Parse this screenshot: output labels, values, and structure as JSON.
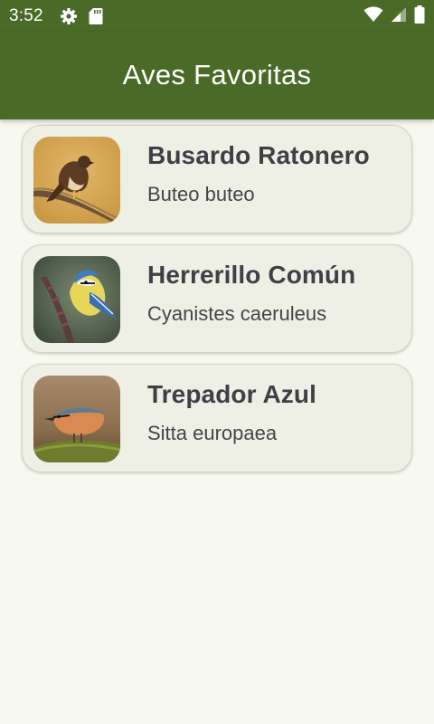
{
  "status_bar": {
    "time": "3:52",
    "icons_left": [
      "gear-icon",
      "sd-card-icon"
    ],
    "icons_right": [
      "wifi-icon",
      "cell-signal-icon",
      "battery-icon"
    ]
  },
  "app_bar": {
    "title": "Aves Favoritas",
    "color": "#4a6a28"
  },
  "birds": [
    {
      "name": "Busardo Ratonero",
      "scientific": "Buteo buteo",
      "image": "buzzard-photo"
    },
    {
      "name": "Herrerillo Común",
      "scientific": "Cyanistes caeruleus",
      "image": "blue-tit-photo"
    },
    {
      "name": "Trepador Azul",
      "scientific": "Sitta europaea",
      "image": "nuthatch-photo"
    }
  ]
}
